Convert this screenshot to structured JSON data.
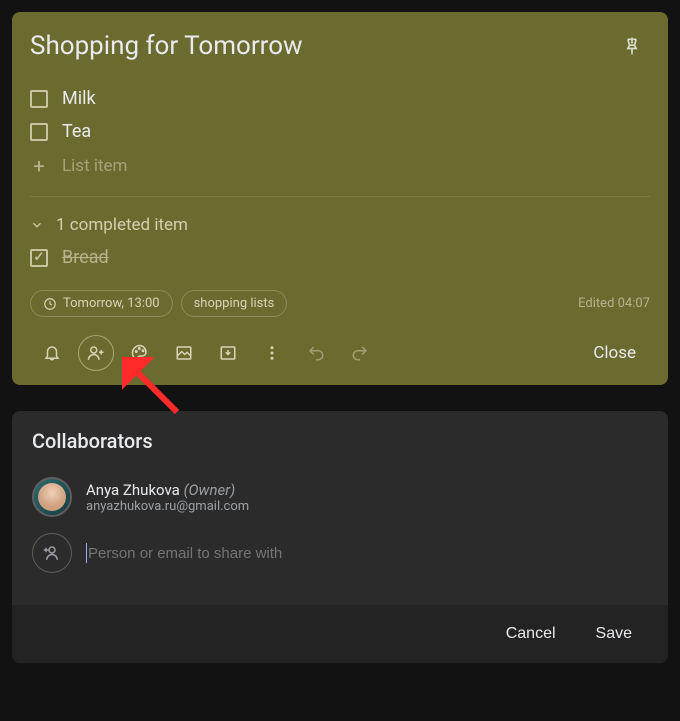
{
  "note": {
    "title": "Shopping for Tomorrow",
    "items": [
      {
        "text": "Milk",
        "done": false
      },
      {
        "text": "Tea",
        "done": false
      }
    ],
    "add_placeholder": "List item",
    "completed_header": "1 completed item",
    "completed_items": [
      {
        "text": "Bread",
        "done": true
      }
    ],
    "reminder": "Tomorrow, 13:00",
    "label": "shopping lists",
    "edited": "Edited 04:07",
    "close_label": "Close"
  },
  "collaborators": {
    "header": "Collaborators",
    "owner": {
      "name": "Anya Zhukova",
      "role": "(Owner)",
      "email": "anyazhukova.ru@gmail.com"
    },
    "input_placeholder": "Person or email to share with",
    "cancel_label": "Cancel",
    "save_label": "Save"
  }
}
